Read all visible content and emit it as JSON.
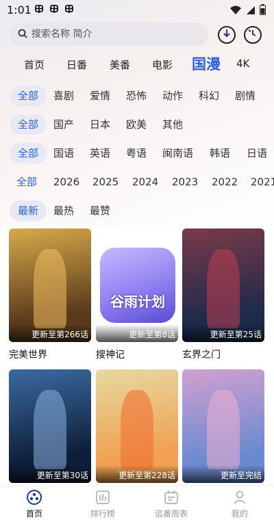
{
  "status_bar": {
    "time": "1:01",
    "app_icons": [
      "bug-icon",
      "bug-icon",
      "bug-icon"
    ]
  },
  "search": {
    "placeholder": "搜索名称 简介"
  },
  "main_tabs": [
    {
      "label": "首页"
    },
    {
      "label": "日番"
    },
    {
      "label": "美番"
    },
    {
      "label": "电影"
    },
    {
      "label": "国漫",
      "active": true
    },
    {
      "label": "4K"
    }
  ],
  "filters": {
    "genre": [
      "全部",
      "喜剧",
      "爱情",
      "恐怖",
      "动作",
      "科幻",
      "剧情"
    ],
    "region": [
      "全部",
      "国产",
      "日本",
      "欧美",
      "其他"
    ],
    "language": [
      "全部",
      "国语",
      "英语",
      "粤语",
      "闽南语",
      "韩语",
      "日语"
    ],
    "year": [
      "全部",
      "2026",
      "2025",
      "2024",
      "2023",
      "2022",
      "2021"
    ],
    "sort": [
      "最新",
      "最热",
      "最赞"
    ]
  },
  "items": [
    {
      "title": "完美世界",
      "badge": "更新至第266话",
      "c1": "#5b3a1c",
      "c2": "#d6a94b",
      "accent": "#f0c060"
    },
    {
      "title": "搜神记",
      "badge": "更新至第8话",
      "c1": "#ffffff",
      "c2": "#ffffff",
      "accent": "#8a7cf0",
      "app_text": "谷雨计划"
    },
    {
      "title": "玄界之门",
      "badge": "更新至第25话",
      "c1": "#1d2a4a",
      "c2": "#7a3a4a",
      "accent": "#c04050"
    },
    {
      "title": "",
      "badge": "更新至第30话",
      "c1": "#0e1e3a",
      "c2": "#3a6aa0",
      "accent": "#8ab0e0"
    },
    {
      "title": "",
      "badge": "更新至第228话",
      "c1": "#f0a050",
      "c2": "#e8d8a0",
      "accent": "#f06a30"
    },
    {
      "title": "",
      "badge": "更新至完结",
      "c1": "#6a8ad0",
      "c2": "#d0a0d0",
      "accent": "#f0b0d0"
    }
  ],
  "bottom_nav": [
    {
      "label": "首页",
      "icon": "home-icon",
      "active": true
    },
    {
      "label": "排行榜",
      "icon": "ranking-icon"
    },
    {
      "label": "追番周表",
      "icon": "calendar-icon"
    },
    {
      "label": "我的",
      "icon": "profile-icon"
    }
  ],
  "colors": {
    "accent": "#2a62d6",
    "chip_bg": "#e7eaf6"
  }
}
